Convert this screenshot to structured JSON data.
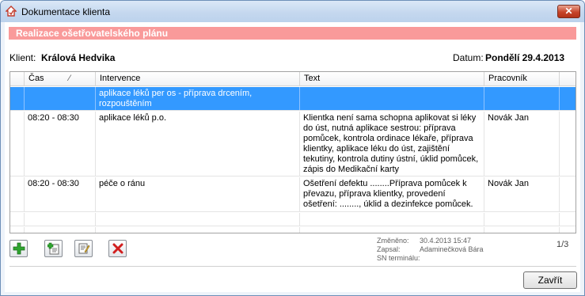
{
  "window": {
    "title": "Dokumentace klienta",
    "close_glyph": "✕"
  },
  "section_header": "Realizace ošetřovatelského plánu",
  "client": {
    "label": "Klient:",
    "name": "Králová Hedvika"
  },
  "date": {
    "label": "Datum:",
    "value": "Pondělí 29.4.2013"
  },
  "grid": {
    "columns": [
      "Čas",
      "Intervence",
      "Text",
      "Pracovník"
    ],
    "sort_glyph": "⁄",
    "rows": [
      {
        "time": "",
        "intervention": "aplikace léků per os - příprava drcením, rozpouštěním",
        "text": "",
        "worker": "",
        "selected": true
      },
      {
        "time": "08:20 - 08:30",
        "intervention": "aplikace léků p.o.",
        "text": "Klientka není sama schopna aplikovat si léky do úst, nutná aplikace sestrou: příprava pomůcek, kontrola ordinace lékaře, příprava klientky, aplikace léku do úst, zajištění tekutiny, kontrola dutiny ústní, úklid pomůcek, zápis do Medikační karty",
        "worker": "Novák Jan",
        "selected": false
      },
      {
        "time": "08:20 - 08:30",
        "intervention": "péče o ránu",
        "text": "Ošetření defektu ........Příprava pomůcek k převazu, příprava klientky, provedení ošetření: ........, úklid a dezinfekce pomůcek.",
        "worker": "Novák Jan",
        "selected": false
      }
    ]
  },
  "toolbar": {
    "add_icon": "add-icon",
    "add_copy_icon": "add-document-icon",
    "edit_icon": "edit-icon",
    "delete_icon": "delete-icon"
  },
  "meta": {
    "changed_label": "Změněno:",
    "changed_value": "30.4.2013 15:47",
    "written_label": "Zapsal:",
    "written_value": "Adaminečková Bára",
    "sn_label": "SN terminálu:",
    "sn_value": ""
  },
  "pager": "1/3",
  "close_button": "Zavřít",
  "colors": {
    "selection": "#3399ff",
    "section_header": "#f99a9a",
    "delete": "#d11f1f",
    "add": "#2fa52f"
  }
}
